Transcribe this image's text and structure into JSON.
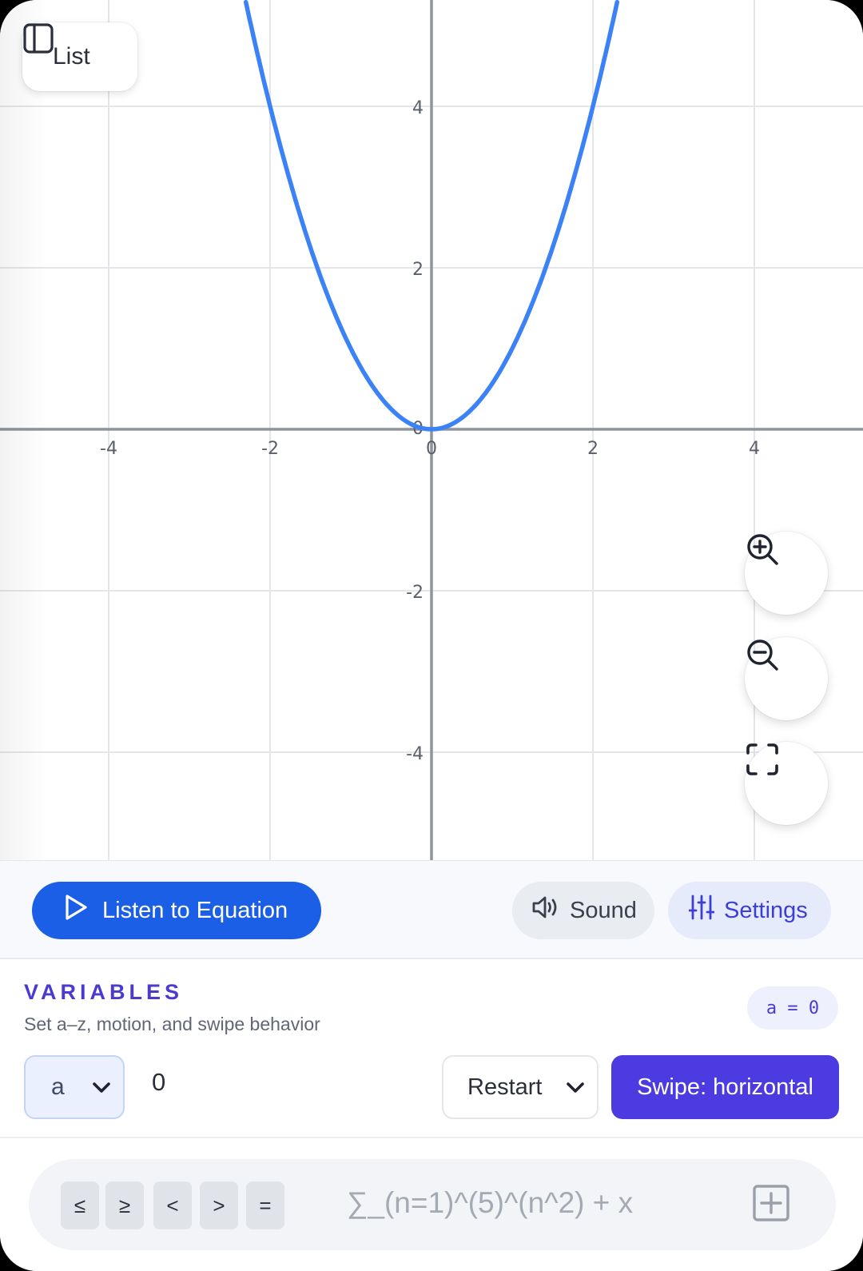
{
  "graph": {
    "x_ticks": [
      "-4",
      "-2",
      "0",
      "2",
      "4"
    ],
    "y_ticks": [
      "4",
      "2",
      "-2",
      "-4"
    ],
    "origin_label": "0",
    "curve_color": "#3b82f6",
    "xlim": [
      -5.35,
      5.35
    ],
    "ylim": [
      -5.3,
      5.3
    ]
  },
  "chart_data": {
    "type": "line",
    "series": [
      {
        "x": [
          -2.3,
          -2,
          -1.5,
          -1,
          -0.5,
          0,
          0.5,
          1,
          1.5,
          2,
          2.3
        ],
        "y": [
          5.29,
          4,
          2.25,
          1,
          0.25,
          0,
          0.25,
          1,
          2.25,
          4,
          5.29
        ]
      }
    ],
    "x_tick_labels": [
      "-4",
      "-2",
      "0",
      "2",
      "4"
    ],
    "y_tick_labels": [
      "-4",
      "-2",
      "2",
      "4"
    ],
    "xlim": [
      -5.35,
      5.35
    ],
    "ylim": [
      -5.3,
      5.3
    ],
    "grid": true
  },
  "list_button": {
    "label": "List",
    "icon": "sidebar-panel-icon"
  },
  "zoom_controls": {
    "zoom_in_icon": "zoom-in-icon",
    "zoom_out_icon": "zoom-out-icon",
    "fit_icon": "fullscreen-icon"
  },
  "toolbar": {
    "listen_label": "Listen to Equation",
    "sound_label": "Sound",
    "settings_label": "Settings"
  },
  "variables": {
    "title": "VARIABLES",
    "subtitle": "Set a–z, motion, and swipe behavior",
    "badge": "a = 0",
    "selected_var": "a",
    "value": "0",
    "motion_mode": "Restart",
    "swipe_label": "Swipe: horizontal"
  },
  "equation": {
    "operators": [
      "≤",
      "≥",
      "<",
      ">",
      "="
    ],
    "placeholder": "∑_(n=1)^(5)^(n^2) + x"
  },
  "colors": {
    "primary_blue": "#1a5fe6",
    "accent_purple": "#4b3be0",
    "curve": "#3b82f6"
  }
}
